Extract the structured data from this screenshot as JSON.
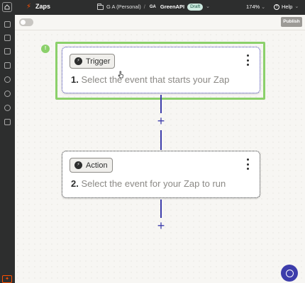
{
  "topbar": {
    "app_title": "Zaps",
    "folder": "G A (Personal)",
    "separator": "/",
    "zap_badge": "GA",
    "zap_name": "GreenAPI",
    "status": "Draft",
    "zoom": "174%",
    "help": "Help",
    "help_icon_glyph": "?"
  },
  "toolbar": {
    "publish": "Publish"
  },
  "canvas": {
    "warning_glyph": "!",
    "steps": [
      {
        "label": "Trigger",
        "number": "1.",
        "text": "Select the event that starts your Zap"
      },
      {
        "label": "Action",
        "number": "2.",
        "text": "Select the event for your Zap to run"
      }
    ],
    "add_glyph": "+"
  },
  "colors": {
    "accent": "#3d3dab",
    "brand": "#ff4f00",
    "highlight": "#8bd06a",
    "topbar_bg": "#2d2e2e"
  },
  "icons": {
    "sidebar": [
      "apps-icon",
      "zaps-icon",
      "chat-icon",
      "calendar-icon",
      "history-icon",
      "transfer-icon",
      "settings-icon",
      "tables-icon"
    ]
  }
}
